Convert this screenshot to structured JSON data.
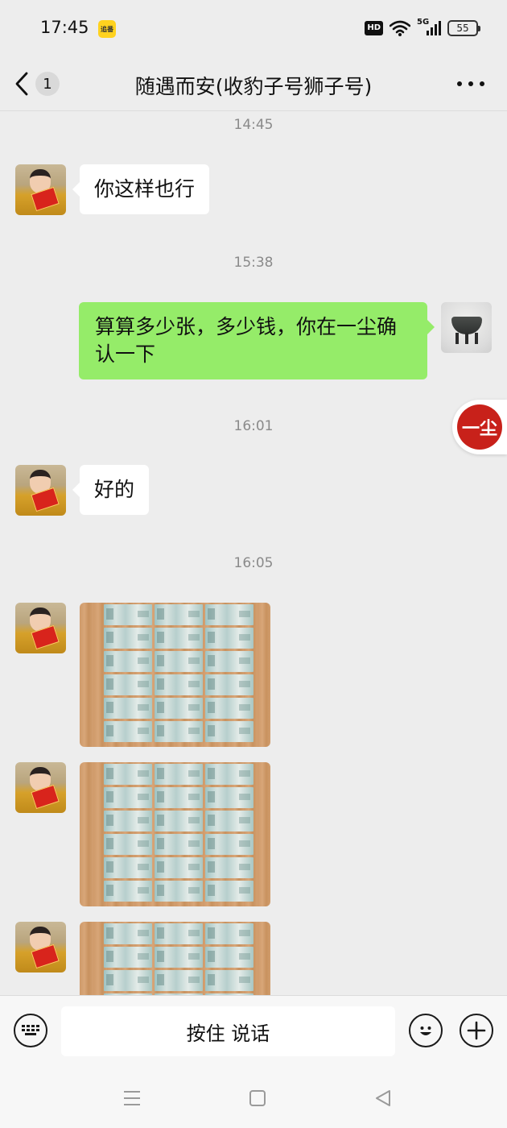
{
  "status_bar": {
    "time": "17:45",
    "app_badge": "追番",
    "hd_label": "HD",
    "network_label": "5G",
    "battery_level": "55"
  },
  "header": {
    "back_count": "1",
    "title": "随遇而安(收豹子号狮子号)",
    "more_icon": "more-dots-icon"
  },
  "messages": [
    {
      "type": "timestamp",
      "text": "14:45"
    },
    {
      "type": "text",
      "direction": "in",
      "text": "你这样也行"
    },
    {
      "type": "timestamp",
      "text": "15:38"
    },
    {
      "type": "text",
      "direction": "out",
      "line1": "算算多少张，多少钱，你在一尘确",
      "line2": "认一下"
    },
    {
      "type": "timestamp",
      "text": "16:01"
    },
    {
      "type": "text",
      "direction": "in",
      "text": "好的"
    },
    {
      "type": "timestamp",
      "text": "16:05"
    },
    {
      "type": "image",
      "direction": "in",
      "description": "banknote-sheet-photo"
    },
    {
      "type": "image",
      "direction": "in",
      "description": "banknote-sheet-photo"
    },
    {
      "type": "image",
      "direction": "in",
      "description": "banknote-sheet-photo"
    }
  ],
  "floating_badge": {
    "text": "一尘"
  },
  "input_bar": {
    "voice_label": "按住 说话",
    "left_icon": "keyboard-icon",
    "emoji_icon": "emoji-icon",
    "plus_icon": "plus-icon"
  },
  "colors": {
    "background": "#ededed",
    "outgoing_bubble": "#95ec69",
    "incoming_bubble": "#ffffff"
  }
}
